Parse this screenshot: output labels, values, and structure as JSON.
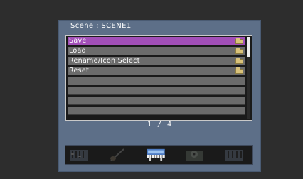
{
  "scene": {
    "title": "Scene : SCENE1"
  },
  "menu": {
    "items": [
      {
        "label": "Save",
        "selected": true,
        "icon": "folder-icon"
      },
      {
        "label": "Load",
        "selected": false,
        "icon": "folder-icon"
      },
      {
        "label": "Rename/Icon Select",
        "selected": false,
        "icon": "folder-icon"
      },
      {
        "label": "Reset",
        "selected": false,
        "icon": "folder-icon"
      },
      {
        "label": ""
      },
      {
        "label": ""
      },
      {
        "label": ""
      },
      {
        "label": ""
      }
    ]
  },
  "pagination": {
    "text": "1 / 4"
  },
  "icons": [
    {
      "name": "mixer-icon",
      "active": false
    },
    {
      "name": "guitar-icon",
      "active": false
    },
    {
      "name": "piano-icon",
      "active": true
    },
    {
      "name": "turntable-icon",
      "active": false
    },
    {
      "name": "mixer-icon-2",
      "active": false
    }
  ],
  "colors": {
    "panel": "#5d6f88",
    "selected_row": "#a24fb8",
    "row": "#6b6b6b",
    "background": "#2d2d2d"
  }
}
